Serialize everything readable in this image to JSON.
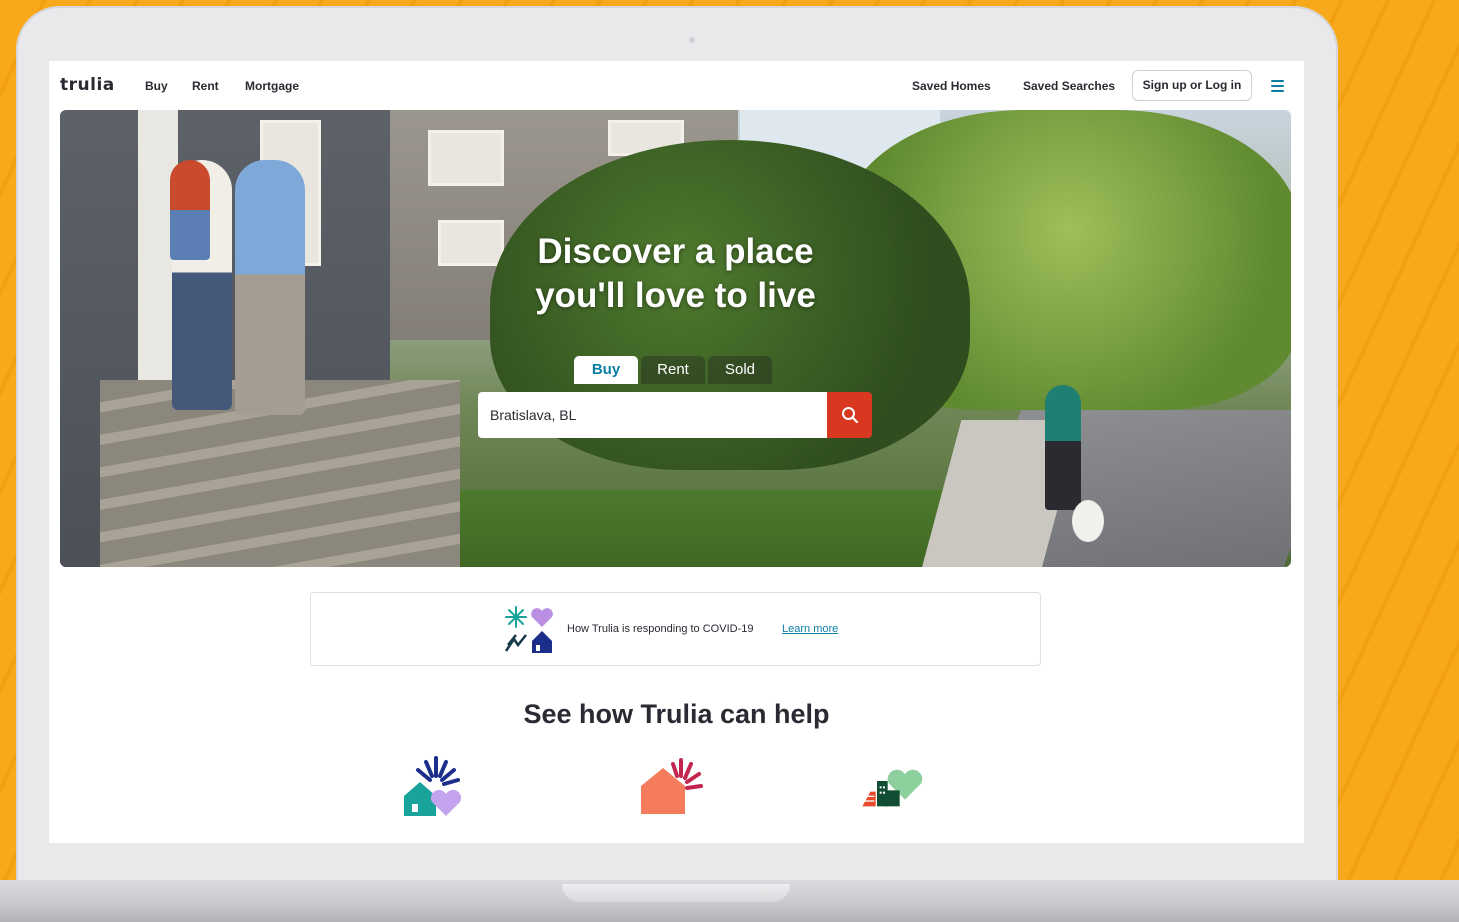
{
  "header": {
    "logo": "trulia",
    "nav": [
      "Buy",
      "Rent",
      "Mortgage"
    ],
    "saved_homes": "Saved Homes",
    "saved_searches": "Saved Searches",
    "signup": "Sign up or Log in"
  },
  "hero": {
    "title_line1": "Discover a place",
    "title_line2": "you'll love to live",
    "tabs": [
      "Buy",
      "Rent",
      "Sold"
    ],
    "active_tab": "Buy",
    "search_value": "Bratislava, BL"
  },
  "covid": {
    "text": "How Trulia is responding to COVID-19",
    "link": "Learn more"
  },
  "help": {
    "title": "See how Trulia can help"
  },
  "colors": {
    "accent": "#0b7ea3",
    "search_button": "#d8381f",
    "background": "#f7a81b"
  },
  "icons": [
    "menu-icon",
    "search-icon",
    "covid-illustration-icon",
    "house-heart-icon",
    "house-sun-icon",
    "building-heart-icon"
  ]
}
